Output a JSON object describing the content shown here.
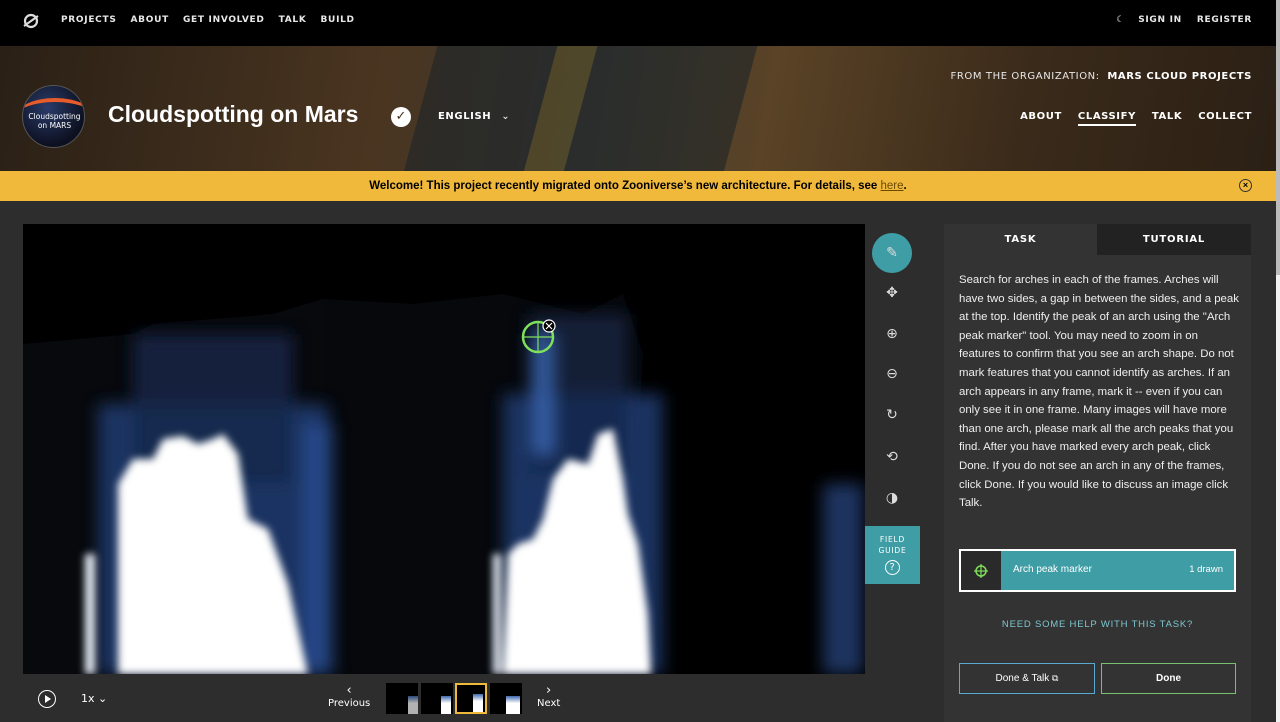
{
  "topnav": {
    "items": [
      "PROJECTS",
      "ABOUT",
      "GET INVOLVED",
      "TALK",
      "BUILD"
    ],
    "sign_in": "SIGN IN",
    "register": "REGISTER"
  },
  "hero": {
    "avatar_text_1": "Cloudspotting",
    "avatar_text_2": "on MARS",
    "title": "Cloudspotting on Mars",
    "language": "ENGLISH",
    "org_prefix": "FROM THE ORGANIZATION:",
    "org_name": "MARS CLOUD PROJECTS",
    "nav": [
      "ABOUT",
      "CLASSIFY",
      "TALK",
      "COLLECT"
    ]
  },
  "banner": {
    "text": "Welcome! This project recently migrated onto Zooniverse’s new architecture. For details, see ",
    "link": "here",
    "end": "."
  },
  "toolbar": {
    "field_guide_1": "FIELD",
    "field_guide_2": "GUIDE",
    "field_guide_q": "?"
  },
  "controls": {
    "speed": "1x",
    "previous": "Previous",
    "next": "Next"
  },
  "panel": {
    "tab_task": "TASK",
    "tab_tutorial": "TUTORIAL",
    "instructions": "Search for arches in each of the frames. Arches will have two sides, a gap in between the sides, and a peak at the top. Identify the peak of an arch using the \"Arch peak marker\" tool. You may need to zoom in on features to confirm that you see an arch shape. Do not mark features that you cannot identify as arches. If an arch appears in any frame, mark it -- even if you can only see it in one frame. Many images will have more than one arch, please mark all the arch peaks that you find. After you have marked every arch peak, click Done. If you do not see an arch in any of the frames, click Done. If you would like to discuss an image click Talk.",
    "tool_label": "Arch peak marker",
    "tool_count": "1 drawn",
    "help": "NEED SOME HELP WITH THIS TASK?",
    "done_talk": "Done & Talk",
    "done": "Done"
  },
  "colors": {
    "accent": "#3f9da5",
    "banner": "#f0b93c",
    "marker": "#7fe05a"
  }
}
